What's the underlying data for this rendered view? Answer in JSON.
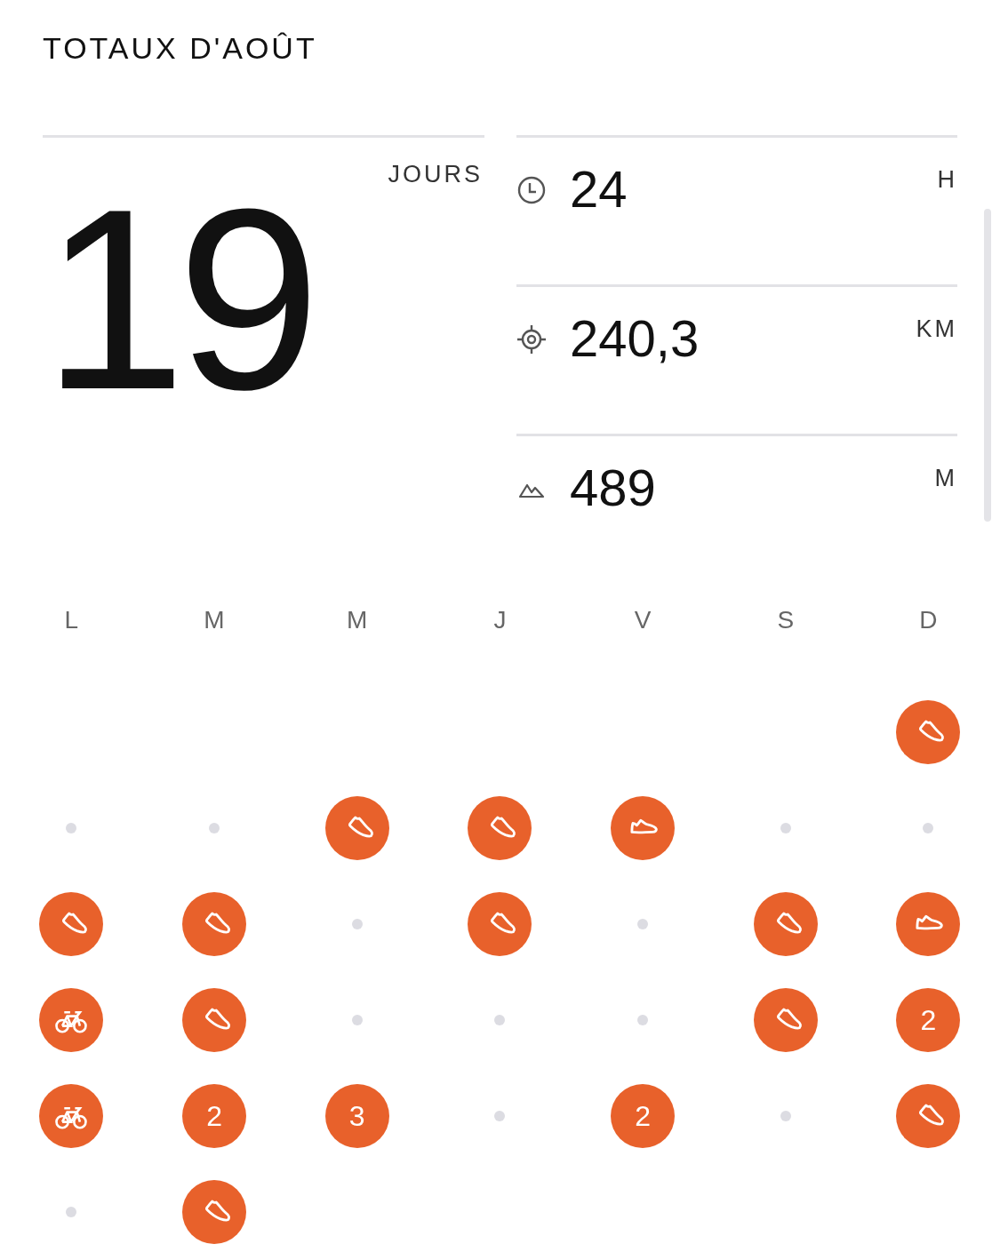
{
  "title": "TOTAUX D'AOÛT",
  "days_total": {
    "value": "19",
    "unit": "JOURS"
  },
  "stats": [
    {
      "kind": "time",
      "value": "24",
      "unit": "H"
    },
    {
      "kind": "distance",
      "value": "240,3",
      "unit": "KM"
    },
    {
      "kind": "elevation",
      "value": "489",
      "unit": "M"
    }
  ],
  "weekdays": [
    "L",
    "M",
    "M",
    "J",
    "V",
    "S",
    "D"
  ],
  "weeks": [
    [
      {
        "kind": "empty"
      },
      {
        "kind": "empty"
      },
      {
        "kind": "empty"
      },
      {
        "kind": "empty"
      },
      {
        "kind": "empty"
      },
      {
        "kind": "empty"
      },
      {
        "kind": "run"
      }
    ],
    [
      {
        "kind": "rest"
      },
      {
        "kind": "rest"
      },
      {
        "kind": "run"
      },
      {
        "kind": "run"
      },
      {
        "kind": "walk"
      },
      {
        "kind": "rest"
      },
      {
        "kind": "rest"
      }
    ],
    [
      {
        "kind": "run"
      },
      {
        "kind": "run"
      },
      {
        "kind": "rest"
      },
      {
        "kind": "run"
      },
      {
        "kind": "rest"
      },
      {
        "kind": "run"
      },
      {
        "kind": "walk"
      }
    ],
    [
      {
        "kind": "ride"
      },
      {
        "kind": "run"
      },
      {
        "kind": "rest"
      },
      {
        "kind": "rest"
      },
      {
        "kind": "rest"
      },
      {
        "kind": "run"
      },
      {
        "kind": "count",
        "text": "2"
      }
    ],
    [
      {
        "kind": "ride"
      },
      {
        "kind": "count",
        "text": "2"
      },
      {
        "kind": "count",
        "text": "3"
      },
      {
        "kind": "rest"
      },
      {
        "kind": "count",
        "text": "2"
      },
      {
        "kind": "rest"
      },
      {
        "kind": "run"
      }
    ],
    [
      {
        "kind": "rest"
      },
      {
        "kind": "run"
      },
      {
        "kind": "empty"
      },
      {
        "kind": "empty"
      },
      {
        "kind": "empty"
      },
      {
        "kind": "empty"
      },
      {
        "kind": "empty"
      }
    ]
  ]
}
